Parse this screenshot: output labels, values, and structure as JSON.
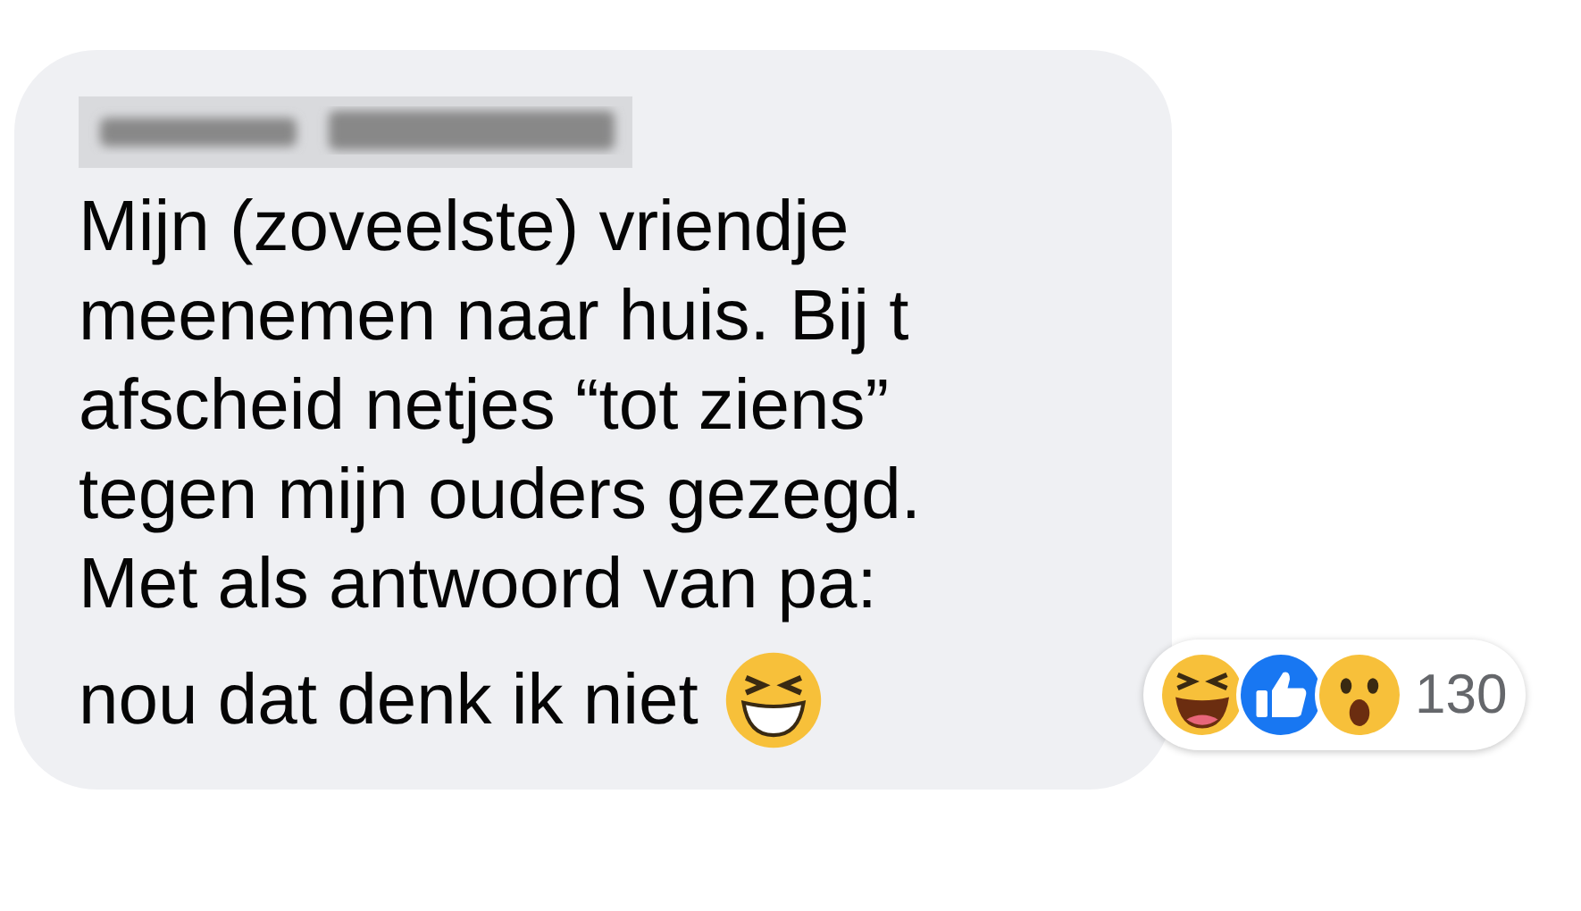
{
  "comment": {
    "lines": [
      "Mijn (zoveelste) vriendje",
      "meenemen naar huis. Bij t",
      "afscheid netjes “tot ziens”",
      "tegen mijn ouders gezegd.",
      "Met als antwoord van pa:"
    ],
    "last_line": "nou dat denk ik niet"
  },
  "reactions": {
    "items": [
      {
        "kind": "laugh"
      },
      {
        "kind": "like"
      },
      {
        "kind": "wow"
      }
    ],
    "count": "130"
  }
}
